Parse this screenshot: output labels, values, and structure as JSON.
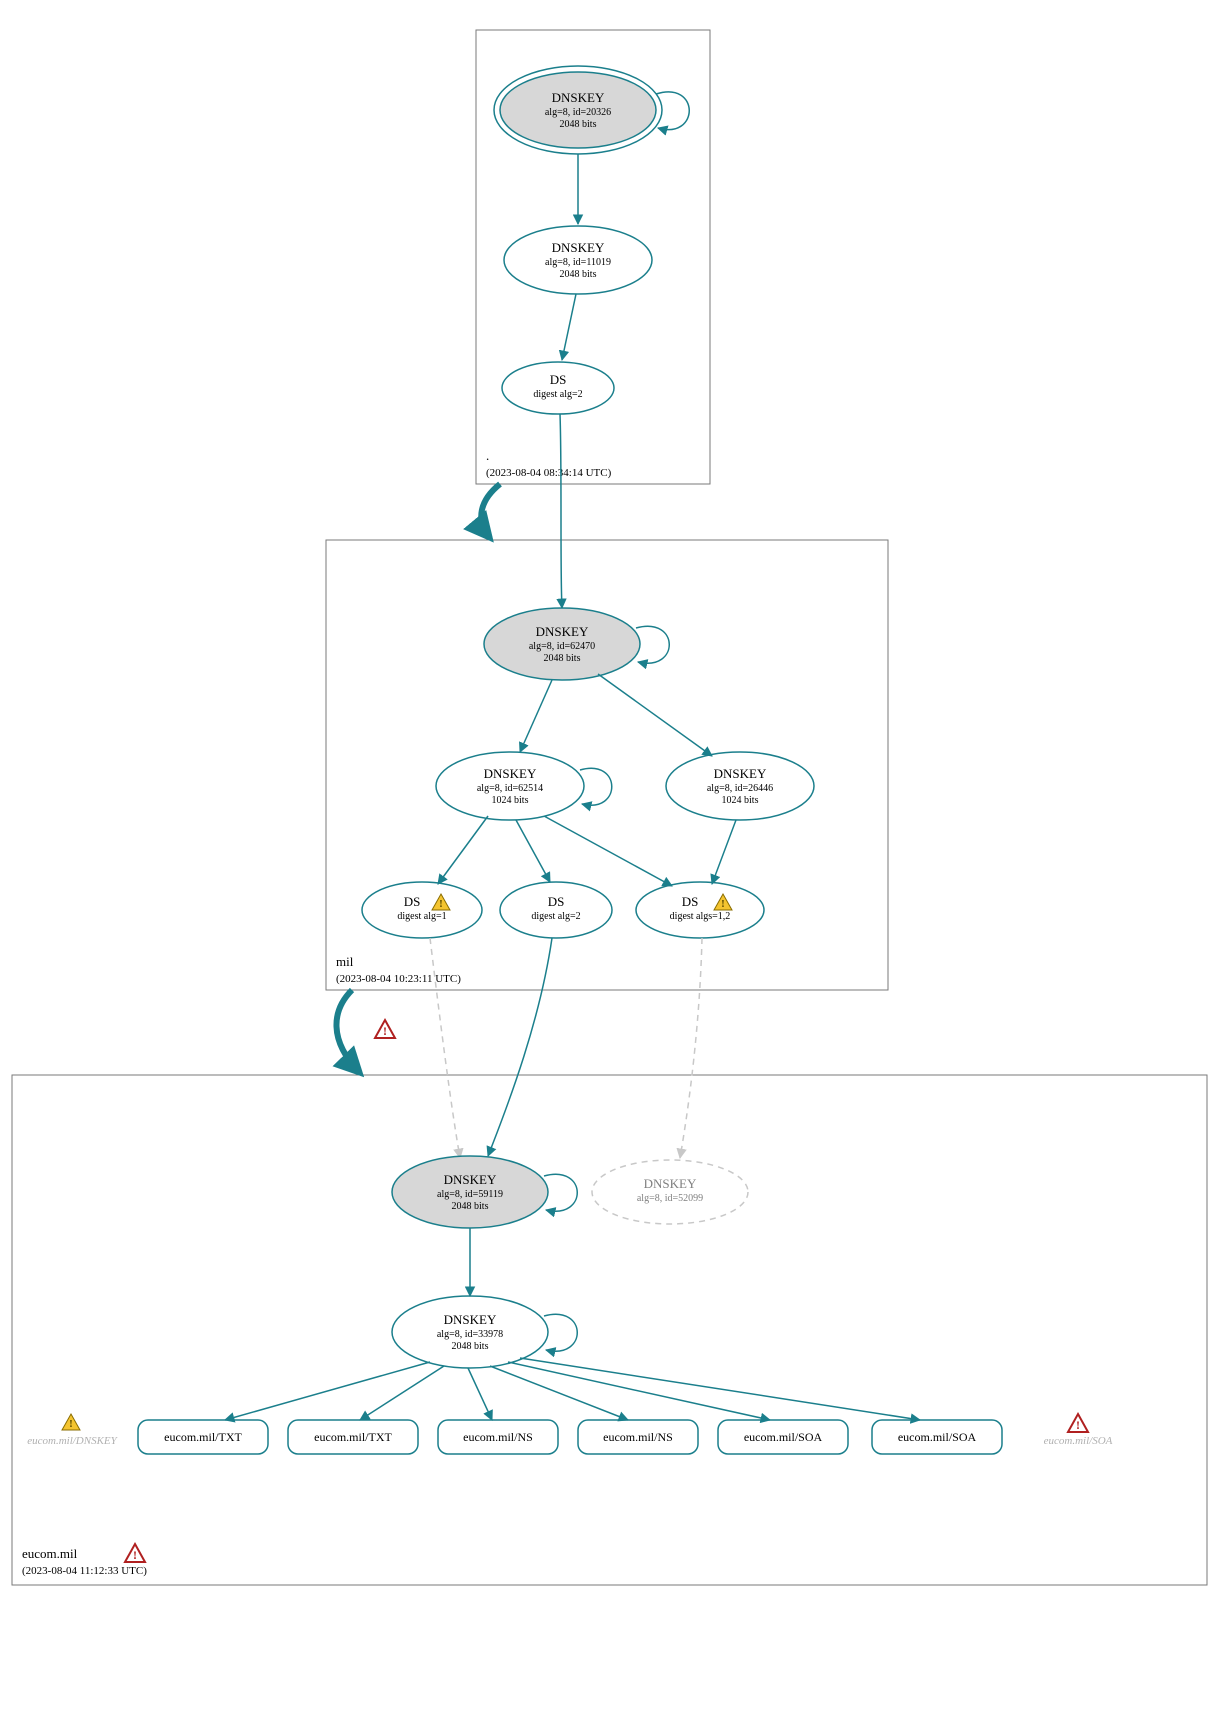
{
  "colors": {
    "teal": "#1b7f8c",
    "grayFill": "#d7d7d7",
    "boxStroke": "#7a7a7a",
    "light": "#c8c8c8",
    "warn": "#f4c430",
    "errStroke": "#b02020"
  },
  "zones": {
    "root": {
      "label": ".",
      "timestamp": "(2023-08-04 08:34:14 UTC)"
    },
    "mil": {
      "label": "mil",
      "timestamp": "(2023-08-04 10:23:11 UTC)"
    },
    "eucom": {
      "label": "eucom.mil",
      "timestamp": "(2023-08-04 11:12:33 UTC)"
    }
  },
  "nodes": {
    "root_ksk": {
      "title": "DNSKEY",
      "l1": "alg=8, id=20326",
      "l2": "2048 bits"
    },
    "root_zsk": {
      "title": "DNSKEY",
      "l1": "alg=8, id=11019",
      "l2": "2048 bits"
    },
    "root_ds": {
      "title": "DS",
      "l1": "digest alg=2",
      "l2": ""
    },
    "mil_ksk": {
      "title": "DNSKEY",
      "l1": "alg=8, id=62470",
      "l2": "2048 bits"
    },
    "mil_zsk1": {
      "title": "DNSKEY",
      "l1": "alg=8, id=62514",
      "l2": "1024 bits"
    },
    "mil_zsk2": {
      "title": "DNSKEY",
      "l1": "alg=8, id=26446",
      "l2": "1024 bits"
    },
    "mil_ds1": {
      "title": "DS",
      "l1": "digest alg=1",
      "l2": ""
    },
    "mil_ds2": {
      "title": "DS",
      "l1": "digest alg=2",
      "l2": ""
    },
    "mil_ds3": {
      "title": "DS",
      "l1": "digest algs=1,2",
      "l2": ""
    },
    "eu_ksk": {
      "title": "DNSKEY",
      "l1": "alg=8, id=59119",
      "l2": "2048 bits"
    },
    "eu_zsk": {
      "title": "DNSKEY",
      "l1": "alg=8, id=33978",
      "l2": "2048 bits"
    },
    "eu_ghost": {
      "title": "DNSKEY",
      "l1": "alg=8, id=52099",
      "l2": ""
    }
  },
  "rr": {
    "ghost_dnskey": "eucom.mil/DNSKEY",
    "txt1": "eucom.mil/TXT",
    "txt2": "eucom.mil/TXT",
    "ns1": "eucom.mil/NS",
    "ns2": "eucom.mil/NS",
    "soa1": "eucom.mil/SOA",
    "soa2": "eucom.mil/SOA",
    "ghost_soa": "eucom.mil/SOA"
  }
}
